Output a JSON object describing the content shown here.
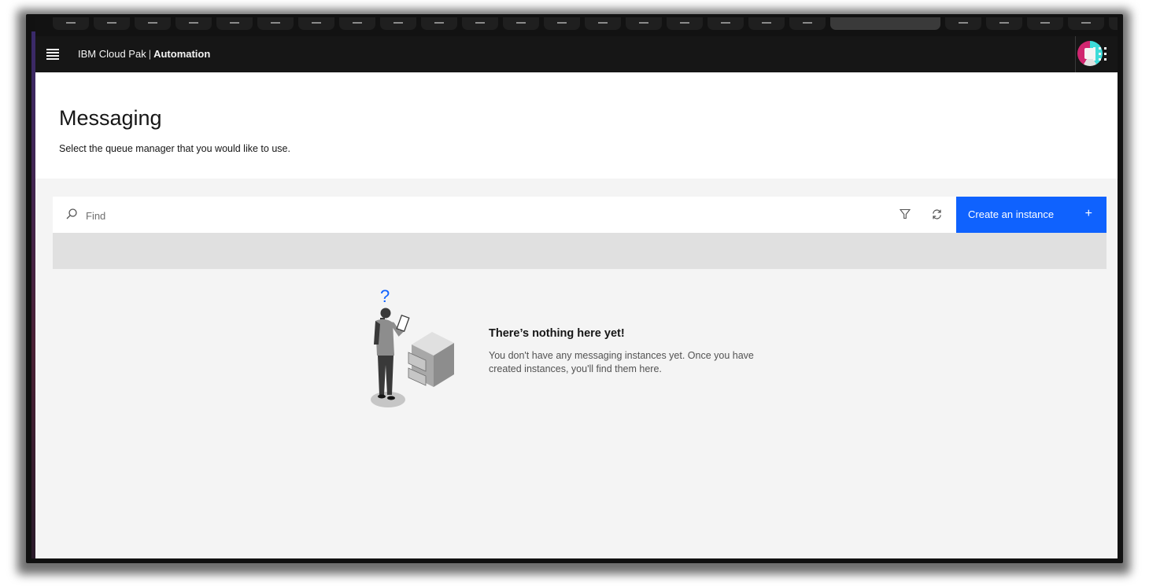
{
  "header": {
    "brand_prefix": "IBM Cloud Pak",
    "brand_separator": "|",
    "brand_product": "Automation"
  },
  "page": {
    "title": "Messaging",
    "subtitle": "Select the queue manager that you would like to use."
  },
  "toolbar": {
    "search_placeholder": "Find",
    "create_label": "Create an instance",
    "create_icon": "+"
  },
  "empty_state": {
    "title": "There’s nothing here yet!",
    "body": "You don't have any messaging instances yet. Once you have created instances, you'll find them here."
  },
  "icons": {
    "menu": "hamburger-icon",
    "avatar": "user-avatar",
    "apps": "app-switcher-grid-icon",
    "search": "search-icon",
    "filter": "filter-icon",
    "refresh": "refresh-icon",
    "illustration": "person-question-mark-with-cabinet"
  },
  "colors": {
    "topbar": "#161616",
    "primary_button": "#0f62fe",
    "page_bg": "#f4f4f4",
    "question_mark": "#0f62fe"
  }
}
